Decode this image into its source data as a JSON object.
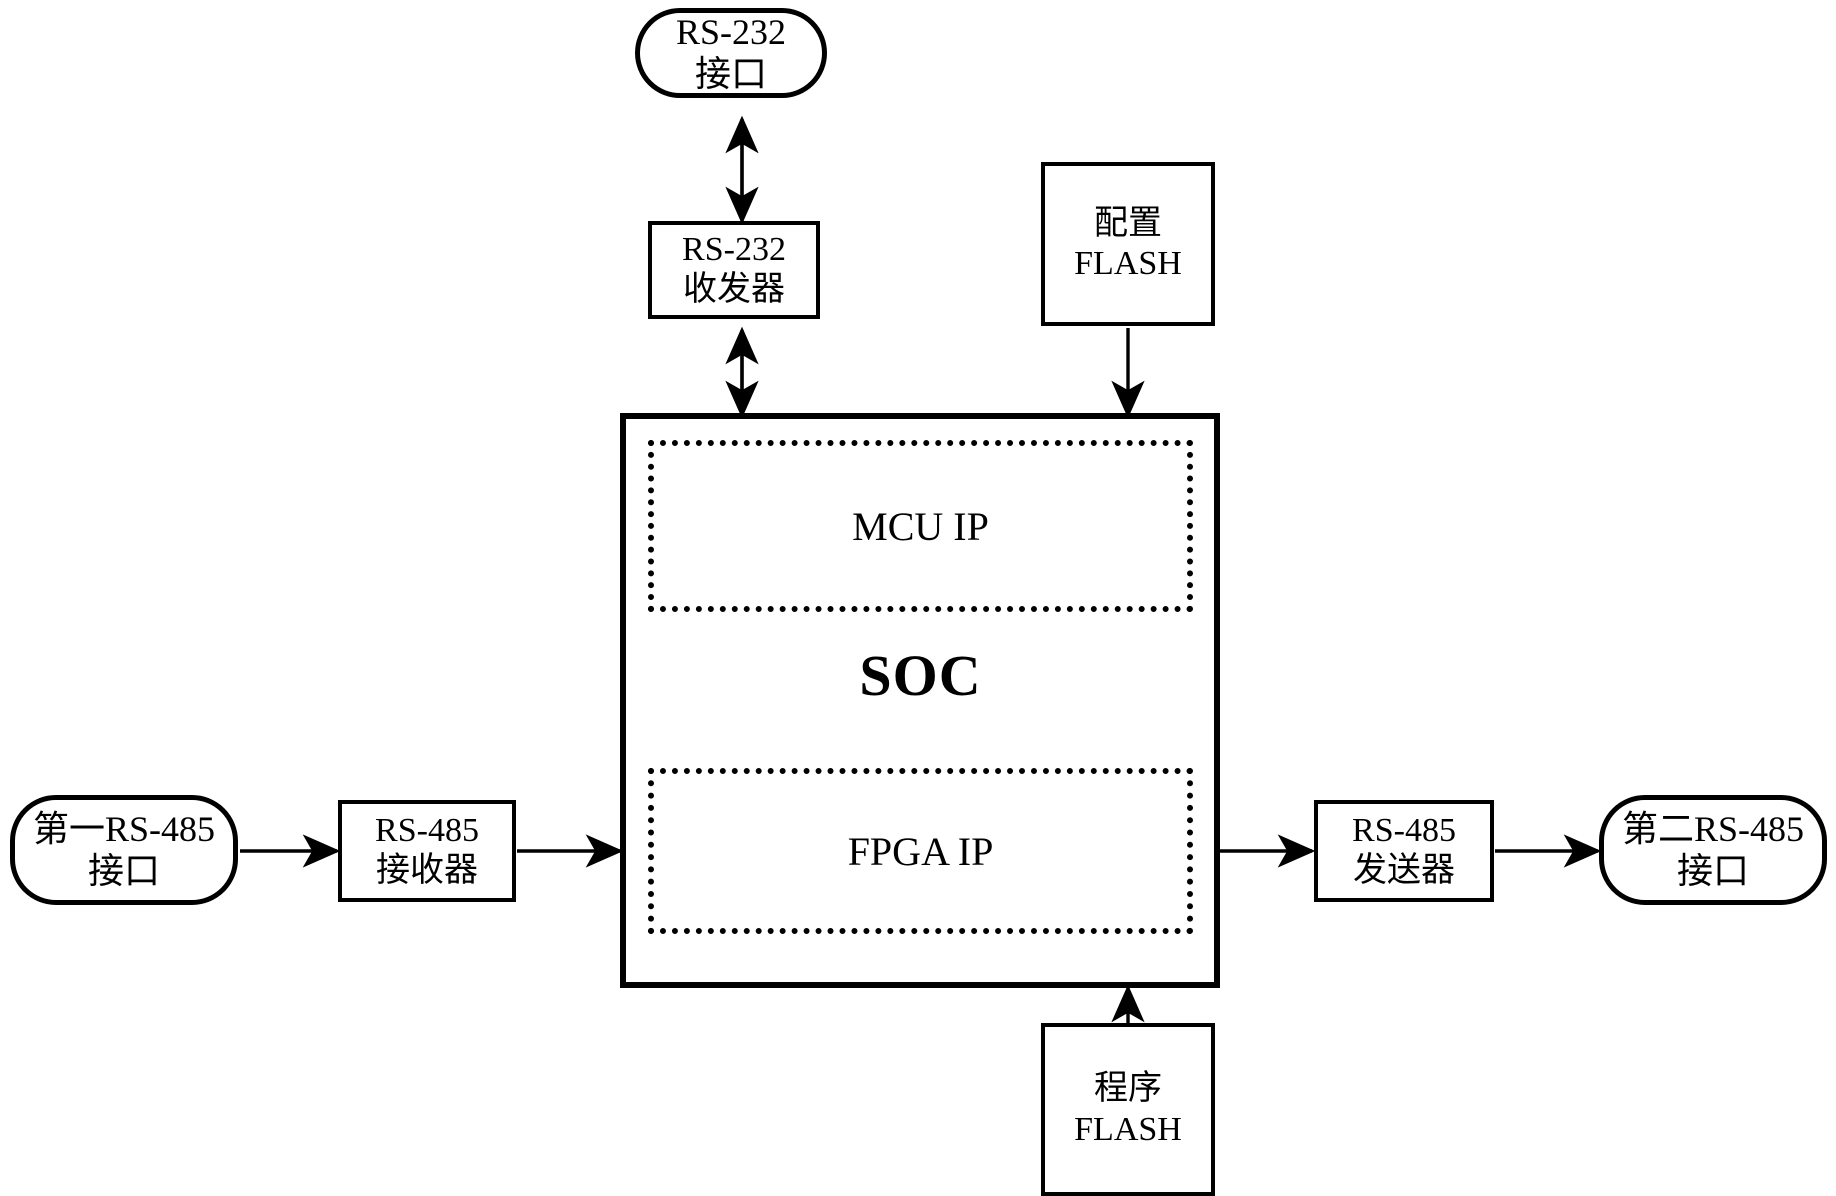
{
  "diagram": {
    "title": "SOC based RS-232 / RS-485 communication block diagram",
    "stroke_color": "#000000",
    "background_color": "#ffffff"
  },
  "nodes": {
    "rs232_interface": {
      "line1": "RS-232",
      "line2": "接口",
      "shape": "rounded-rect"
    },
    "rs232_transceiver": {
      "line1": "RS-232",
      "line2": "收发器",
      "shape": "rect"
    },
    "config_flash": {
      "line1": "配置",
      "line2": "FLASH",
      "shape": "rect"
    },
    "program_flash": {
      "line1": "程序",
      "line2": "FLASH",
      "shape": "rect"
    },
    "soc": {
      "label": "SOC",
      "shape": "rect"
    },
    "mcu_ip": {
      "label": "MCU IP",
      "shape": "dotted-rect"
    },
    "fpga_ip": {
      "label": "FPGA IP",
      "shape": "dotted-rect"
    },
    "first_rs485_interface": {
      "line1": "第一RS-485",
      "line2": "接口",
      "shape": "rounded-rect"
    },
    "rs485_receiver": {
      "line1": "RS-485",
      "line2": "接收器",
      "shape": "rect"
    },
    "rs485_transmitter": {
      "line1": "RS-485",
      "line2": "发送器",
      "shape": "rect"
    },
    "second_rs485_interface": {
      "line1": "第二RS-485",
      "line2": "接口",
      "shape": "rounded-rect"
    }
  },
  "connections": [
    {
      "name": "rs232-interface-to-transceiver",
      "from": "rs232_transceiver",
      "to": "rs232_interface",
      "arrow": "double",
      "orientation": "vertical"
    },
    {
      "name": "rs232-transceiver-to-soc",
      "from": "rs232_transceiver",
      "to": "soc",
      "arrow": "double",
      "orientation": "vertical"
    },
    {
      "name": "config-flash-to-soc",
      "from": "config_flash",
      "to": "soc",
      "arrow": "single",
      "orientation": "vertical"
    },
    {
      "name": "program-flash-to-soc",
      "from": "program_flash",
      "to": "soc",
      "arrow": "single",
      "orientation": "vertical"
    },
    {
      "name": "first-rs485-interface-to-receiver",
      "from": "first_rs485_interface",
      "to": "rs485_receiver",
      "arrow": "single",
      "orientation": "horizontal"
    },
    {
      "name": "rs485-receiver-to-soc",
      "from": "rs485_receiver",
      "to": "soc",
      "arrow": "single",
      "orientation": "horizontal"
    },
    {
      "name": "soc-to-rs485-transmitter",
      "from": "soc",
      "to": "rs485_transmitter",
      "arrow": "single",
      "orientation": "horizontal"
    },
    {
      "name": "rs485-transmitter-to-second-interface",
      "from": "rs485_transmitter",
      "to": "second_rs485_interface",
      "arrow": "single",
      "orientation": "horizontal"
    }
  ]
}
